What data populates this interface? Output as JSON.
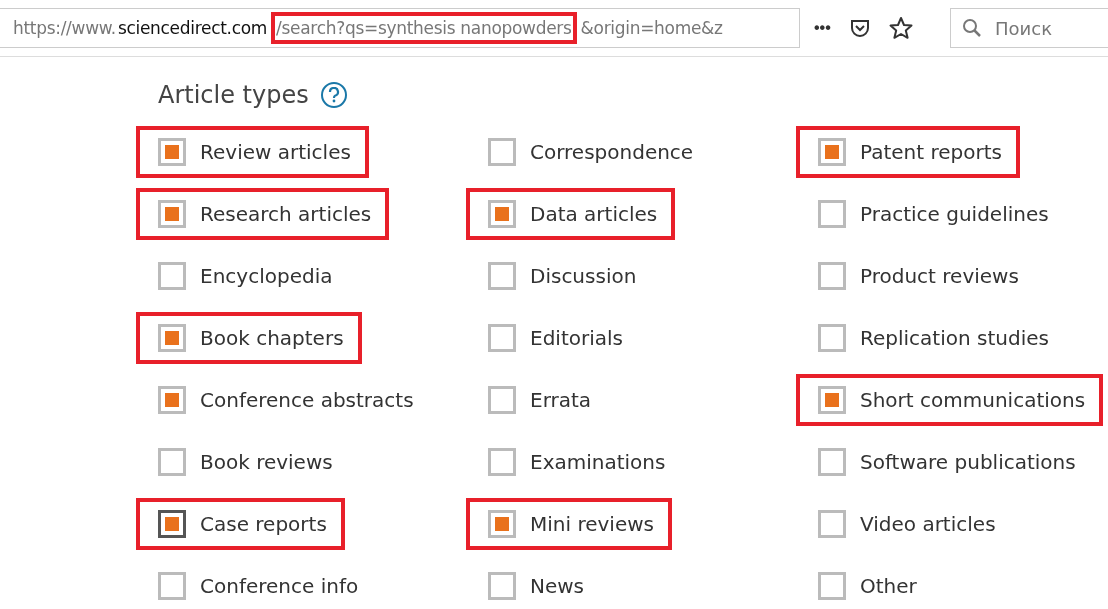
{
  "browser": {
    "url_parts": [
      {
        "text": "https://www.",
        "kind": "plain",
        "highlighted": false
      },
      {
        "text": "sciencedirect.com",
        "kind": "domain",
        "highlighted": false
      },
      {
        "text": "/search?qs=synthesis nanopowders",
        "kind": "plain",
        "highlighted": true
      },
      {
        "text": "&origin=home&z",
        "kind": "plain",
        "highlighted": false
      }
    ],
    "more_button": "•••",
    "search": {
      "placeholder": "Поиск"
    }
  },
  "filter": {
    "title": "Article types",
    "items": [
      {
        "label": "Review articles",
        "checked": true,
        "highlighted": true,
        "focused": false
      },
      {
        "label": "Correspondence",
        "checked": false,
        "highlighted": false,
        "focused": false
      },
      {
        "label": "Patent reports",
        "checked": true,
        "highlighted": true,
        "focused": false
      },
      {
        "label": "Research articles",
        "checked": true,
        "highlighted": true,
        "focused": false
      },
      {
        "label": "Data articles",
        "checked": true,
        "highlighted": true,
        "focused": false
      },
      {
        "label": "Practice guidelines",
        "checked": false,
        "highlighted": false,
        "focused": false
      },
      {
        "label": "Encyclopedia",
        "checked": false,
        "highlighted": false,
        "focused": false
      },
      {
        "label": "Discussion",
        "checked": false,
        "highlighted": false,
        "focused": false
      },
      {
        "label": "Product reviews",
        "checked": false,
        "highlighted": false,
        "focused": false
      },
      {
        "label": "Book chapters",
        "checked": true,
        "highlighted": true,
        "focused": false
      },
      {
        "label": "Editorials",
        "checked": false,
        "highlighted": false,
        "focused": false
      },
      {
        "label": "Replication studies",
        "checked": false,
        "highlighted": false,
        "focused": false
      },
      {
        "label": "Conference abstracts",
        "checked": true,
        "highlighted": false,
        "focused": false
      },
      {
        "label": "Errata",
        "checked": false,
        "highlighted": false,
        "focused": false
      },
      {
        "label": "Short communications",
        "checked": true,
        "highlighted": true,
        "focused": false
      },
      {
        "label": "Book reviews",
        "checked": false,
        "highlighted": false,
        "focused": false
      },
      {
        "label": "Examinations",
        "checked": false,
        "highlighted": false,
        "focused": false
      },
      {
        "label": "Software publications",
        "checked": false,
        "highlighted": false,
        "focused": false
      },
      {
        "label": "Case reports",
        "checked": true,
        "highlighted": true,
        "focused": true
      },
      {
        "label": "Mini reviews",
        "checked": true,
        "highlighted": true,
        "focused": false
      },
      {
        "label": "Video articles",
        "checked": false,
        "highlighted": false,
        "focused": false
      },
      {
        "label": "Conference info",
        "checked": false,
        "highlighted": false,
        "focused": false
      },
      {
        "label": "News",
        "checked": false,
        "highlighted": false,
        "focused": false
      },
      {
        "label": "Other",
        "checked": false,
        "highlighted": false,
        "focused": false
      }
    ]
  }
}
